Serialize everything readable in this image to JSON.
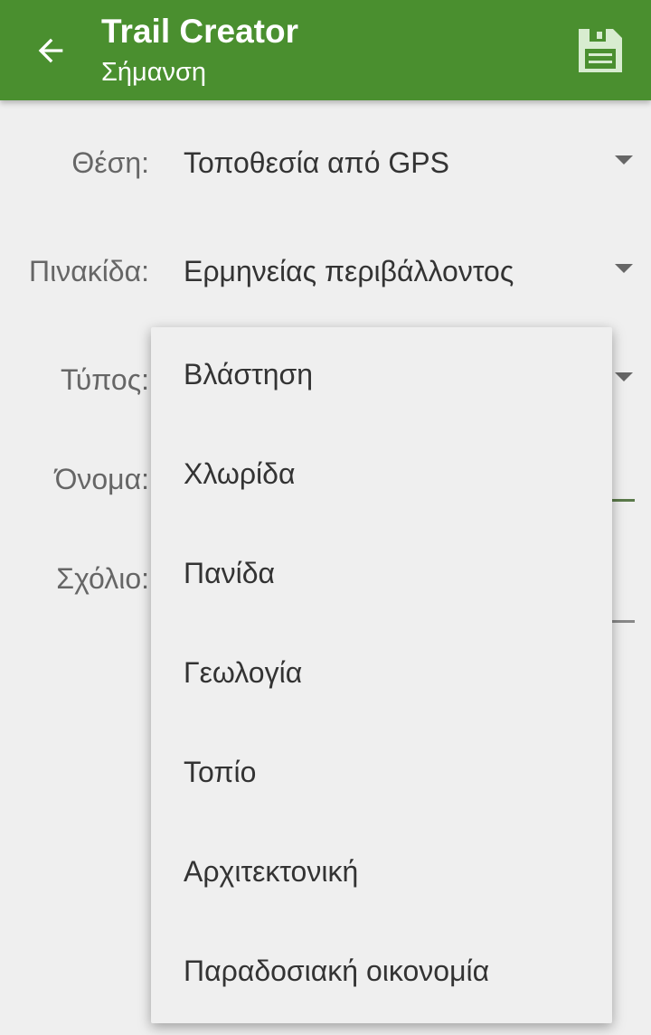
{
  "appbar": {
    "title": "Trail Creator",
    "subtitle": "Σήμανση",
    "back_icon": "arrow-left-icon",
    "save_icon": "floppy-disk-icon",
    "color": "#4a8f2f"
  },
  "form": {
    "position": {
      "label": "Θέση:",
      "value": "Τοποθεσία από GPS"
    },
    "sign": {
      "label": "Πινακίδα:",
      "value": "Ερμηνείας περιβάλλοντος"
    },
    "type": {
      "label": "Τύπος:"
    },
    "name": {
      "label": "Όνομα:"
    },
    "comment": {
      "label": "Σχόλιο:"
    }
  },
  "dropdown": {
    "options": [
      "Βλάστηση",
      "Χλωρίδα",
      "Πανίδα",
      "Γεωλογία",
      "Τοπίο",
      "Αρχιτεκτονική",
      "Παραδοσιακή οικονομία"
    ]
  }
}
